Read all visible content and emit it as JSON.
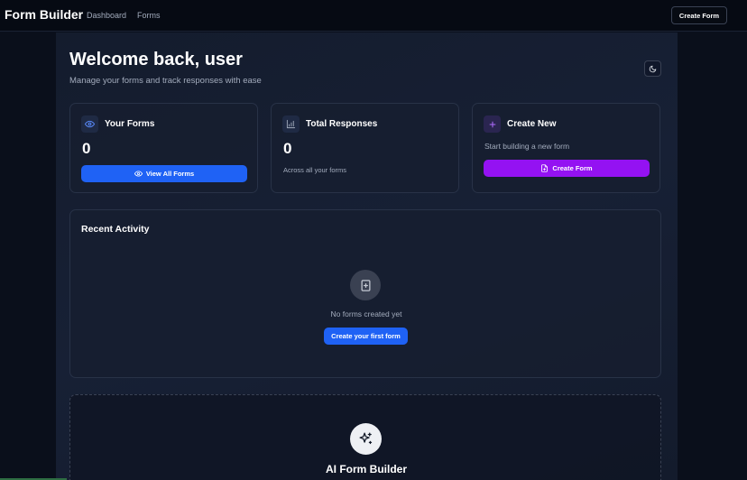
{
  "nav": {
    "brand": "Form Builder",
    "links": [
      "Dashboard",
      "Forms"
    ],
    "create_label": "Create Form"
  },
  "header": {
    "title": "Welcome back, user",
    "subtitle": "Manage your forms and track responses with ease",
    "theme_toggle_icon": "moon-icon"
  },
  "cards": {
    "forms": {
      "icon": "eye-icon",
      "title": "Your Forms",
      "value": "0",
      "button_icon": "eye-icon",
      "button_label": "View All Forms"
    },
    "responses": {
      "icon": "bar-chart-icon",
      "title": "Total Responses",
      "value": "0",
      "note": "Across all your forms"
    },
    "create": {
      "icon": "plus-icon",
      "title": "Create New",
      "description": "Start building a new form",
      "button_icon": "file-plus-icon",
      "button_label": "Create Form"
    }
  },
  "activity": {
    "title": "Recent Activity",
    "empty_icon": "file-plus-icon",
    "empty_text": "No forms created yet",
    "cta_label": "Create your first form"
  },
  "ai_builder": {
    "icon": "sparkles-icon",
    "title": "AI Form Builder"
  },
  "colors": {
    "primary_blue": "#1f62f5",
    "accent_purple": "#9412f2",
    "background": "#0a0f1c",
    "card_border": "#283247"
  }
}
